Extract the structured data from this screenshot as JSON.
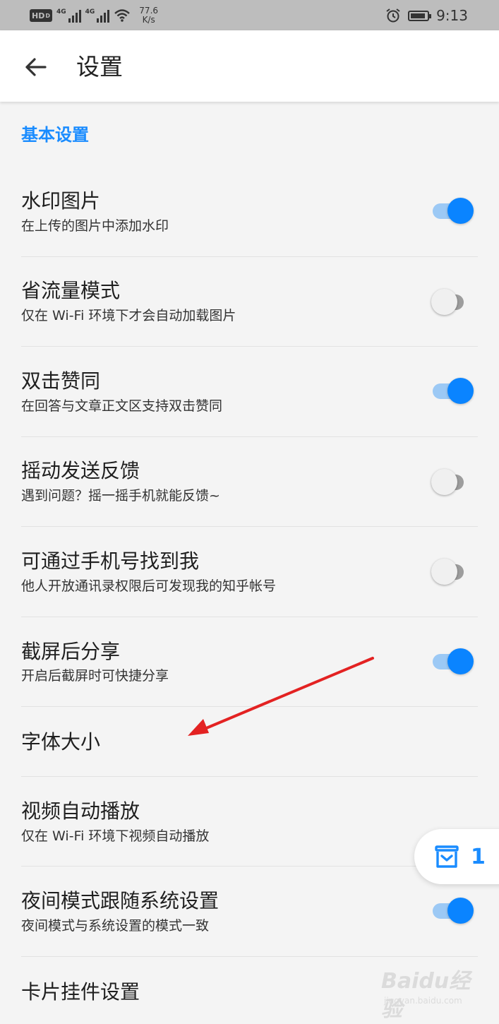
{
  "status_bar": {
    "hd_label": "HD",
    "hd_sub": "D",
    "signal1_label": "4G",
    "signal2_label": "4G",
    "speed_value": "77.6",
    "speed_unit": "K/s",
    "time": "9:13",
    "icons": [
      "wifi-icon",
      "alarm-icon",
      "battery-icon"
    ]
  },
  "header": {
    "back_icon": "arrow-left-icon",
    "title": "设置"
  },
  "section": {
    "title": "基本设置"
  },
  "items": [
    {
      "title": "水印图片",
      "subtitle": "在上传的图片中添加水印",
      "toggle": true
    },
    {
      "title": "省流量模式",
      "subtitle": "仅在 Wi-Fi 环境下才会自动加载图片",
      "toggle": false
    },
    {
      "title": "双击赞同",
      "subtitle": "在回答与文章正文区支持双击赞同",
      "toggle": true
    },
    {
      "title": "摇动发送反馈",
      "subtitle": "遇到问题？摇一摇手机就能反馈~",
      "toggle": false
    },
    {
      "title": "可通过手机号找到我",
      "subtitle": "他人开放通讯录权限后可发现我的知乎帐号",
      "toggle": false
    },
    {
      "title": "截屏后分享",
      "subtitle": "开启后截屏时可快捷分享",
      "toggle": true
    },
    {
      "title": "字体大小",
      "subtitle": "",
      "toggle": null
    },
    {
      "title": "视频自动播放",
      "subtitle": "仅在 Wi-Fi 环境下视频自动播放",
      "toggle": null
    },
    {
      "title": "夜间模式跟随系统设置",
      "subtitle": "夜间模式与系统设置的模式一致",
      "toggle": true
    },
    {
      "title": "卡片挂件设置",
      "subtitle": "",
      "toggle": null
    }
  ],
  "floating_button": {
    "icon": "inbox-icon",
    "count": "1"
  },
  "watermark": {
    "logo_text": "Baidu经验",
    "url_text": "jingyan.baidu.com"
  },
  "colors": {
    "accent": "#1a8cff",
    "toggle_on": "#0a84ff",
    "annotation_arrow": "#e32222"
  }
}
